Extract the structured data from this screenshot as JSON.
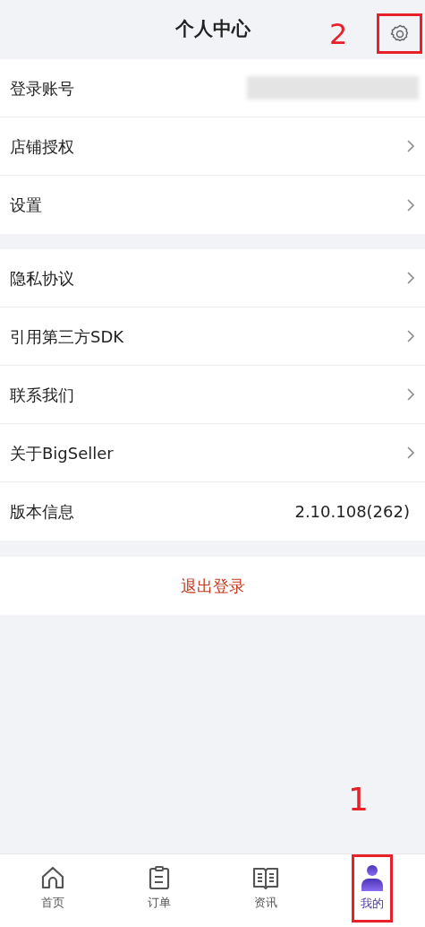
{
  "header": {
    "title": "个人中心",
    "callout": "2",
    "settings_highlighted": true
  },
  "groups": [
    {
      "rows": [
        {
          "label": "登录账号",
          "kind": "hidden_value"
        },
        {
          "label": "店铺授权",
          "kind": "link"
        },
        {
          "label": "设置",
          "kind": "link"
        }
      ]
    },
    {
      "rows": [
        {
          "label": "隐私协议",
          "kind": "link"
        },
        {
          "label": "引用第三方SDK",
          "kind": "link"
        },
        {
          "label": "联系我们",
          "kind": "link"
        },
        {
          "label": "关于BigSeller",
          "kind": "link"
        },
        {
          "label": "版本信息",
          "kind": "value",
          "value": "2.10.108(262)"
        }
      ]
    }
  ],
  "logout": {
    "label": "退出登录"
  },
  "tab_bar": {
    "callout": "1",
    "tabs": [
      {
        "label": "首页",
        "kind": "home",
        "selected": false,
        "highlighted": false
      },
      {
        "label": "订单",
        "kind": "orders",
        "selected": false,
        "highlighted": false
      },
      {
        "label": "资讯",
        "kind": "news",
        "selected": false,
        "highlighted": false
      },
      {
        "label": "我的",
        "kind": "profile",
        "selected": true,
        "highlighted": true
      }
    ]
  }
}
